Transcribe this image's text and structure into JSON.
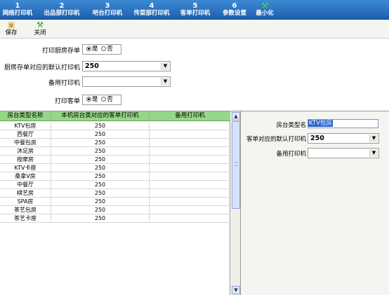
{
  "tabs": [
    {
      "num": "1",
      "label": "网络打印机"
    },
    {
      "num": "2",
      "label": "出品部打印机"
    },
    {
      "num": "3",
      "label": "吧台打印机"
    },
    {
      "num": "4",
      "label": "传菜部打印机"
    },
    {
      "num": "5",
      "label": "客单打印机"
    },
    {
      "num": "6",
      "label": "参数设置"
    }
  ],
  "minimize": {
    "label": "最小化",
    "icon": "minimize-icon"
  },
  "toolbar": {
    "save_label": "保存",
    "close_label": "关闭",
    "save_icon": "save-disk-icon",
    "close_icon": "close-icon"
  },
  "form": {
    "print_kitchen_label": "打印厨房存单",
    "kitchen_default_label": "厨房存单对应的默认打印机",
    "kitchen_default_value": "250",
    "backup_printer_label": "备用打印机",
    "backup_printer_value": "",
    "print_customer_label": "打印客单",
    "yes": "是",
    "no": "否"
  },
  "grid": {
    "headers": [
      "房台类型名称",
      "本机房台类对应的客单打印机",
      "备用打印机"
    ],
    "rows": [
      [
        "KTV包房",
        "250",
        ""
      ],
      [
        "西餐厅",
        "250",
        ""
      ],
      [
        "中餐包房",
        "250",
        ""
      ],
      [
        "沐足房",
        "250",
        ""
      ],
      [
        "按摩房",
        "250",
        ""
      ],
      [
        "KTV卡座",
        "250",
        ""
      ],
      [
        "桑拿V房",
        "250",
        ""
      ],
      [
        "中餐厅",
        "250",
        ""
      ],
      [
        "棋艺房",
        "250",
        ""
      ],
      [
        "SPA房",
        "250",
        ""
      ],
      [
        "茶艺包房",
        "250",
        ""
      ],
      [
        "茶艺卡座",
        "250",
        ""
      ]
    ]
  },
  "detail": {
    "room_type_label": "房台类型名",
    "room_type_value": "KTV包房",
    "customer_default_label": "客单对应的默认打印机",
    "customer_default_value": "250",
    "backup_label": "备用打印机",
    "backup_value": ""
  },
  "colors": {
    "tabbar": "#2a6fbe",
    "grid_header": "#96d688",
    "selection": "#2a62c9"
  }
}
